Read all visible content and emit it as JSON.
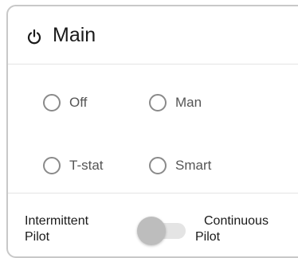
{
  "header": {
    "icon": "power-icon",
    "title": "Main"
  },
  "modes": [
    {
      "label": "Off",
      "selected": false
    },
    {
      "label": "Man",
      "selected": false
    },
    {
      "label": "T-stat",
      "selected": false
    },
    {
      "label": "Smart",
      "selected": false
    }
  ],
  "pilot": {
    "left_label_line1": "Intermittent",
    "left_label_line2": "Pilot",
    "right_label_line1": "Continuous",
    "right_label_line2": "Pilot",
    "continuous_on": false
  },
  "colors": {
    "border": "#c8c8c8",
    "radio": "#8a8a8a",
    "toggle_track": "#e4e4e4",
    "toggle_thumb": "#bdbdbd"
  }
}
